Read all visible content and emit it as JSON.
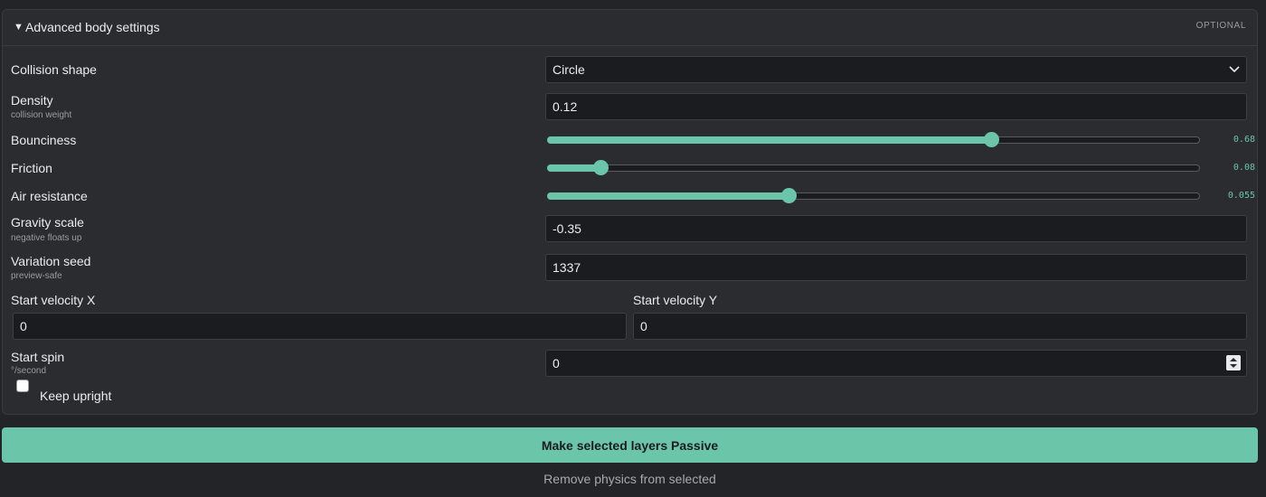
{
  "panel": {
    "title": "Advanced body settings",
    "optional_label": "OPTIONAL",
    "expanded": true
  },
  "fields": {
    "collision_shape": {
      "label": "Collision shape",
      "value": "Circle"
    },
    "density": {
      "label": "Density",
      "sublabel": "collision weight",
      "value": "0.12"
    },
    "bounciness": {
      "label": "Bounciness",
      "value": "0.68",
      "fraction": 0.68
    },
    "friction": {
      "label": "Friction",
      "value": "0.08",
      "fraction": 0.08
    },
    "air_resistance": {
      "label": "Air resistance",
      "value": "0.055",
      "fraction": 0.37
    },
    "gravity_scale": {
      "label": "Gravity scale",
      "sublabel": "negative floats up",
      "value": "-0.35"
    },
    "variation_seed": {
      "label": "Variation seed",
      "sublabel": "preview-safe",
      "value": "1337"
    },
    "start_velocity_x": {
      "label": "Start velocity X",
      "value": "0"
    },
    "start_velocity_y": {
      "label": "Start velocity Y",
      "value": "0"
    },
    "start_spin": {
      "label": "Start spin",
      "sublabel": "°/second",
      "value": "0"
    },
    "keep_upright": {
      "label": "Keep upright",
      "checked": false
    }
  },
  "actions": {
    "primary": "Make selected layers Passive",
    "secondary": "Remove physics from selected"
  },
  "colors": {
    "accent": "#6bc5a8",
    "panel_bg": "#2b2c30",
    "input_bg": "#1b1c1f"
  },
  "icons": {
    "caret": "caret-down-icon",
    "select": "chevron-down-icon",
    "stepper": "stepper-icon"
  }
}
